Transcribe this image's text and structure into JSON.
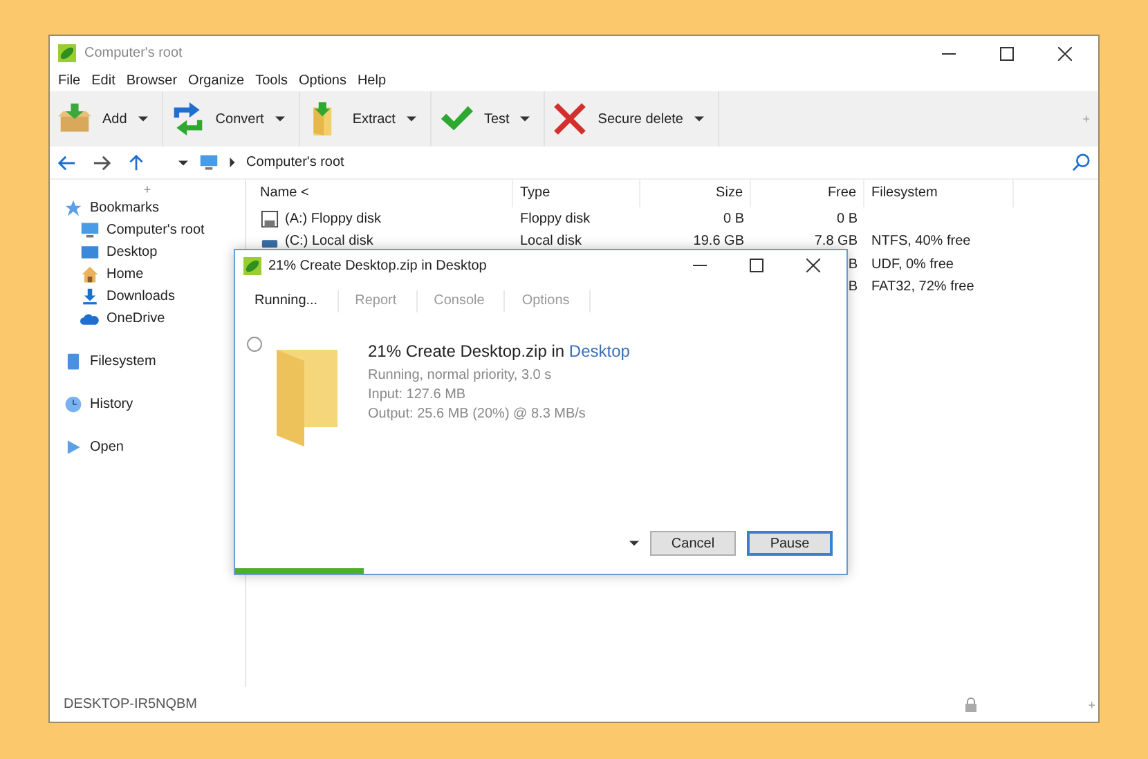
{
  "window": {
    "title": "Computer's root"
  },
  "menu": [
    "File",
    "Edit",
    "Browser",
    "Organize",
    "Tools",
    "Options",
    "Help"
  ],
  "toolbar": {
    "buttons": [
      {
        "label": "Add"
      },
      {
        "label": "Convert"
      },
      {
        "label": "Extract"
      },
      {
        "label": "Test"
      },
      {
        "label": "Secure delete"
      }
    ],
    "extra": "+"
  },
  "address": {
    "path": "Computer's root"
  },
  "sidebar": {
    "toggle": "+",
    "items": [
      {
        "label": "Bookmarks",
        "children": [
          {
            "label": "Computer's root"
          },
          {
            "label": "Desktop"
          },
          {
            "label": "Home"
          },
          {
            "label": "Downloads"
          },
          {
            "label": "OneDrive"
          }
        ]
      },
      {
        "label": "Filesystem"
      },
      {
        "label": "History"
      },
      {
        "label": "Open"
      }
    ]
  },
  "table": {
    "columns": [
      "Name <",
      "Type",
      "Size",
      "Free",
      "Filesystem"
    ],
    "rows": [
      {
        "name": "(A:) Floppy disk",
        "type": "Floppy disk",
        "size": "0 B",
        "free": "0 B",
        "filesystem": ""
      },
      {
        "name": "(C:) Local disk",
        "type": "Local disk",
        "size": "19.6 GB",
        "free": "7.8 GB",
        "filesystem": "NTFS, 40% free"
      },
      {
        "name": "",
        "type": "",
        "size": "",
        "free": "B",
        "filesystem": "UDF, 0% free"
      },
      {
        "name": "",
        "type": "",
        "size": "",
        "free": "B",
        "filesystem": "FAT32, 72% free"
      }
    ]
  },
  "dialog": {
    "title": "21% Create Desktop.zip in Desktop",
    "tabs": [
      {
        "label": "Running...",
        "selected": true
      },
      {
        "label": "Report",
        "selected": false
      },
      {
        "label": "Console",
        "selected": false
      },
      {
        "label": "Options",
        "selected": false
      }
    ],
    "heading": "21% Create Desktop.zip in",
    "heading_link": "Desktop",
    "details": [
      "Running, normal priority, 3.0 s",
      "Input: 127.6 MB",
      "Output: 25.6 MB (20%) @ 8.3 MB/s"
    ],
    "buttons": [
      {
        "label": "Cancel",
        "default": false
      },
      {
        "label": "Pause",
        "default": true
      }
    ],
    "progress": {
      "level": 0.21
    }
  },
  "status_bar": {
    "text": "DESKTOP-IR5NQBM",
    "extra": "+"
  }
}
